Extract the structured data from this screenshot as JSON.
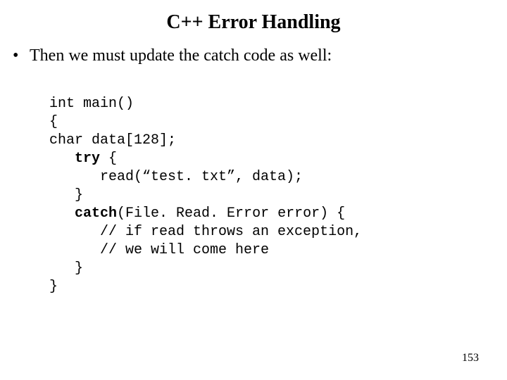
{
  "title": "C++ Error Handling",
  "bullet": "Then we must update the catch code as well:",
  "code": {
    "l1": "int main()",
    "l2": "{",
    "l3": "char data[128];",
    "kw_try": "try",
    "l4_rest": " {",
    "l5": "      read(“test. txt”, data);",
    "l6": "   }",
    "kw_catch": "catch",
    "l7_rest": "(File. Read. Error error) {",
    "l8": "      // if read throws an exception,",
    "l9": "      // we will come here",
    "l10": "   }",
    "l11": "}"
  },
  "page_number": "153"
}
